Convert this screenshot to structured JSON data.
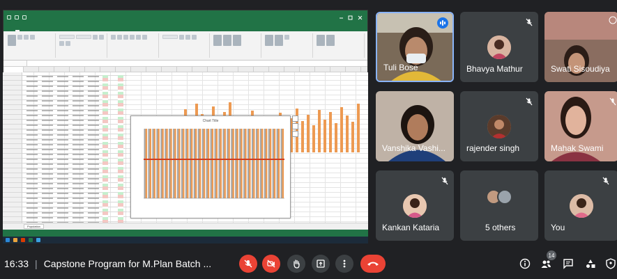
{
  "meeting": {
    "time": "16:33",
    "separator": "|",
    "title": "Capstone Program for M.Plan Batch ..."
  },
  "participants": [
    {
      "name": "Tuli Bose",
      "speaking": true
    },
    {
      "name": "Bhavya Mathur",
      "muted": true
    },
    {
      "name": "Swati Sisoudiya"
    },
    {
      "name": "Vanshika Vashi..."
    },
    {
      "name": "rajender singh",
      "muted": true
    },
    {
      "name": "Mahak Swami"
    },
    {
      "name": "Kankan Kataria",
      "muted": true
    },
    {
      "name": "5 others"
    },
    {
      "name": "You",
      "muted": true
    }
  ],
  "people_count": "14",
  "shared_window": {
    "app": "Excel",
    "chart_title": "Chart Title",
    "sheet_tab": "Population"
  },
  "colors": {
    "background": "#202124",
    "tile": "#3c4043",
    "end_call": "#ea4335",
    "excel_green": "#217346",
    "bar_orange": "#ed9a52",
    "bar_gray": "#a6a6a6",
    "line_red": "#d23c1e"
  },
  "icons": [
    "mic-off-icon",
    "camera-off-icon",
    "raise-hand-icon",
    "present-icon",
    "more-options-icon",
    "end-call-icon",
    "info-icon",
    "people-icon",
    "chat-icon",
    "activities-icon",
    "host-controls-icon"
  ]
}
